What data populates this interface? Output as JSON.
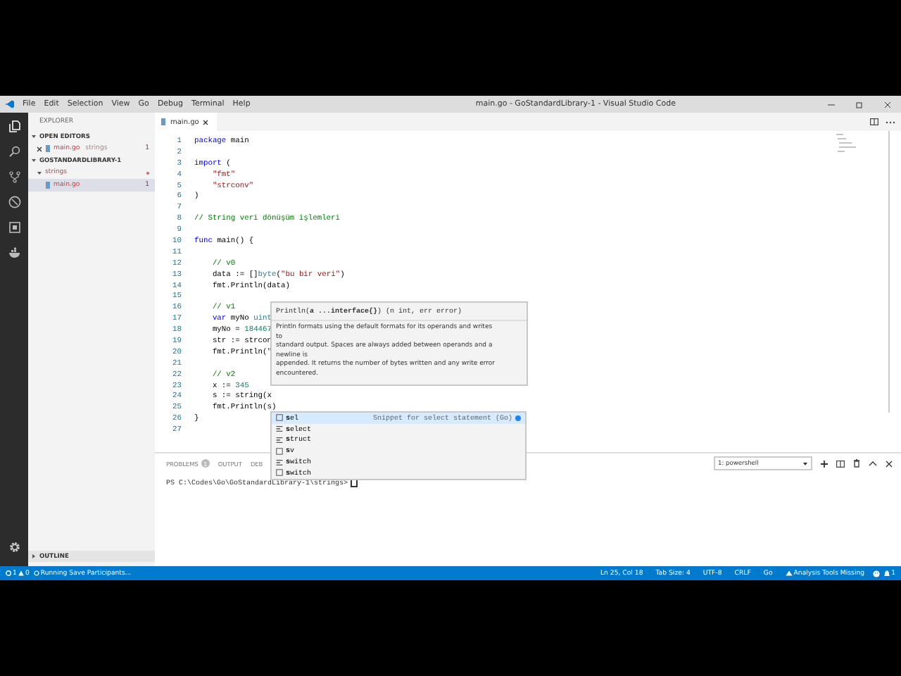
{
  "window": {
    "title": "main.go - GoStandardLibrary-1 - Visual Studio Code"
  },
  "menu": [
    "File",
    "Edit",
    "Selection",
    "View",
    "Go",
    "Debug",
    "Terminal",
    "Help"
  ],
  "sidebar": {
    "title": "EXPLORER",
    "sections": [
      {
        "title": "OPEN EDITORS",
        "expanded": true,
        "items": [
          {
            "name": "main.go",
            "kind": "file",
            "folder": "strings",
            "badge": "1",
            "selected": false,
            "closable": true
          }
        ]
      },
      {
        "title": "GOSTANDARDLIBRARY-1",
        "expanded": true,
        "items": [
          {
            "name": "strings",
            "kind": "folder",
            "modified": true,
            "selected": false,
            "children": [
              {
                "name": "main.go",
                "kind": "file",
                "badge": "1",
                "selected": true
              }
            ]
          }
        ]
      },
      {
        "title": "OUTLINE",
        "expanded": false
      }
    ]
  },
  "editor": {
    "tabs": [
      {
        "label": "main.go",
        "selected": true
      }
    ],
    "lines": [
      {
        "number": "1",
        "tokens": [
          {
            "kind": "keyword",
            "text": "package"
          },
          {
            "kind": "plain",
            "text": " main"
          }
        ]
      },
      {
        "number": "2"
      },
      {
        "number": "3",
        "tokens": [
          {
            "kind": "keyword",
            "text": "import"
          },
          {
            "kind": "plain",
            "text": " ("
          }
        ]
      },
      {
        "number": "4",
        "tokens": [
          {
            "kind": "string",
            "text": "    \"fmt\""
          }
        ]
      },
      {
        "number": "5",
        "tokens": [
          {
            "kind": "string",
            "text": "    \"strconv\""
          }
        ]
      },
      {
        "number": "6",
        "tokens": [
          {
            "kind": "plain",
            "text": ")"
          }
        ]
      },
      {
        "number": "7"
      },
      {
        "number": "8",
        "tokens": [
          {
            "kind": "comment",
            "text": "// String veri dönüşüm işlemleri"
          }
        ]
      },
      {
        "number": "9"
      },
      {
        "number": "10",
        "tokens": [
          {
            "kind": "keyword",
            "text": "func"
          },
          {
            "kind": "plain",
            "text": " main() {"
          }
        ]
      },
      {
        "number": "11"
      },
      {
        "number": "12",
        "tokens": [
          {
            "kind": "comment",
            "text": "    // v0"
          }
        ]
      },
      {
        "number": "13",
        "tokens": [
          {
            "kind": "plain",
            "text": "    data := []"
          },
          {
            "kind": "type",
            "text": "byte"
          },
          {
            "kind": "plain",
            "text": "("
          },
          {
            "kind": "string",
            "text": "\"bu bir veri\""
          },
          {
            "kind": "plain",
            "text": ")"
          }
        ]
      },
      {
        "number": "14",
        "tokens": [
          {
            "kind": "plain",
            "text": "    fmt.Println(data)"
          }
        ]
      },
      {
        "number": "15"
      },
      {
        "number": "16",
        "tokens": [
          {
            "kind": "comment",
            "text": "    // v1"
          }
        ]
      },
      {
        "number": "17",
        "tokens": [
          {
            "kind": "keyword",
            "text": "    var"
          },
          {
            "kind": "plain",
            "text": " myNo "
          },
          {
            "kind": "type",
            "text": "uint"
          }
        ]
      },
      {
        "number": "18",
        "tokens": [
          {
            "kind": "plain",
            "text": "    myNo = "
          },
          {
            "kind": "number",
            "text": "184467"
          }
        ]
      },
      {
        "number": "19",
        "tokens": [
          {
            "kind": "plain",
            "text": "    str := strcon"
          }
        ]
      },
      {
        "number": "20",
        "tokens": [
          {
            "kind": "plain",
            "text": "    fmt.Println("
          },
          {
            "kind": "string",
            "text": "\""
          }
        ]
      },
      {
        "number": "21"
      },
      {
        "number": "22",
        "tokens": [
          {
            "kind": "comment",
            "text": "    // v2"
          }
        ]
      },
      {
        "number": "23",
        "tokens": [
          {
            "kind": "plain",
            "text": "    x := "
          },
          {
            "kind": "number",
            "text": "345"
          }
        ]
      },
      {
        "number": "24",
        "tokens": [
          {
            "kind": "plain",
            "text": "    s := string(x"
          }
        ]
      },
      {
        "number": "25",
        "tokens": [
          {
            "kind": "plain",
            "text": "    fmt.Println(s)"
          }
        ]
      },
      {
        "number": "26",
        "tokens": [
          {
            "kind": "plain",
            "text": "}"
          }
        ]
      },
      {
        "number": "27"
      }
    ],
    "hover": {
      "signature": "Println(**a ...interface{}**) (n int, err error)",
      "doc": [
        "Println formats using the default formats for its operands and writes",
        "to",
        "standard output. Spaces are always added between operands and a",
        "newline is",
        "appended. It returns the number of bytes written and any write error",
        "encountered."
      ]
    },
    "suggestions": [
      {
        "label": "**s**el",
        "kind": "snippet",
        "selected": true,
        "detail": "Snippet for select statement (Go)"
      },
      {
        "label": "**s**elect",
        "kind": "keyword",
        "selected": false
      },
      {
        "label": "**s**truct",
        "kind": "keyword",
        "selected": false
      },
      {
        "label": "**s**v",
        "kind": "snippet",
        "selected": false
      },
      {
        "label": "**s**witch",
        "kind": "keyword",
        "selected": false
      },
      {
        "label": "**s**witch",
        "kind": "snippet",
        "selected": false
      }
    ]
  },
  "panel": {
    "tabs": [
      {
        "label": "PROBLEMS",
        "badge": "1",
        "selected": false
      },
      {
        "label": "OUTPUT",
        "selected": false
      },
      {
        "label": "DEB",
        "selected": false
      }
    ],
    "terminal_select": "1: powershell",
    "terminal_lines": [
      "PS C:\\Codes\\Go\\GoStandardLibrary-1\\strings>"
    ]
  },
  "status_bar": {
    "errors": "1",
    "warnings": "0",
    "task": "Running Save Participants...",
    "items": [
      "Ln 25, Col 18",
      "Tab Size: 4",
      "UTF-8",
      "CRLF",
      "Go"
    ],
    "analysis": "Analysis Tools Missing",
    "notifications": "1"
  }
}
